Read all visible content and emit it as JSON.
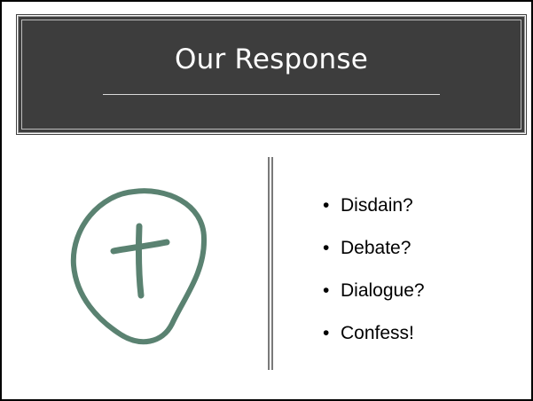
{
  "slide": {
    "title": "Our Response",
    "emblem_icon": "cross-in-circle-icon",
    "accent_color": "#5a8271",
    "bullets": [
      {
        "bullet": "•",
        "text": "Disdain?"
      },
      {
        "bullet": "•",
        "text": "Debate?"
      },
      {
        "bullet": "•",
        "text": "Dialogue?"
      },
      {
        "bullet": "•",
        "text": "Confess!"
      }
    ]
  }
}
